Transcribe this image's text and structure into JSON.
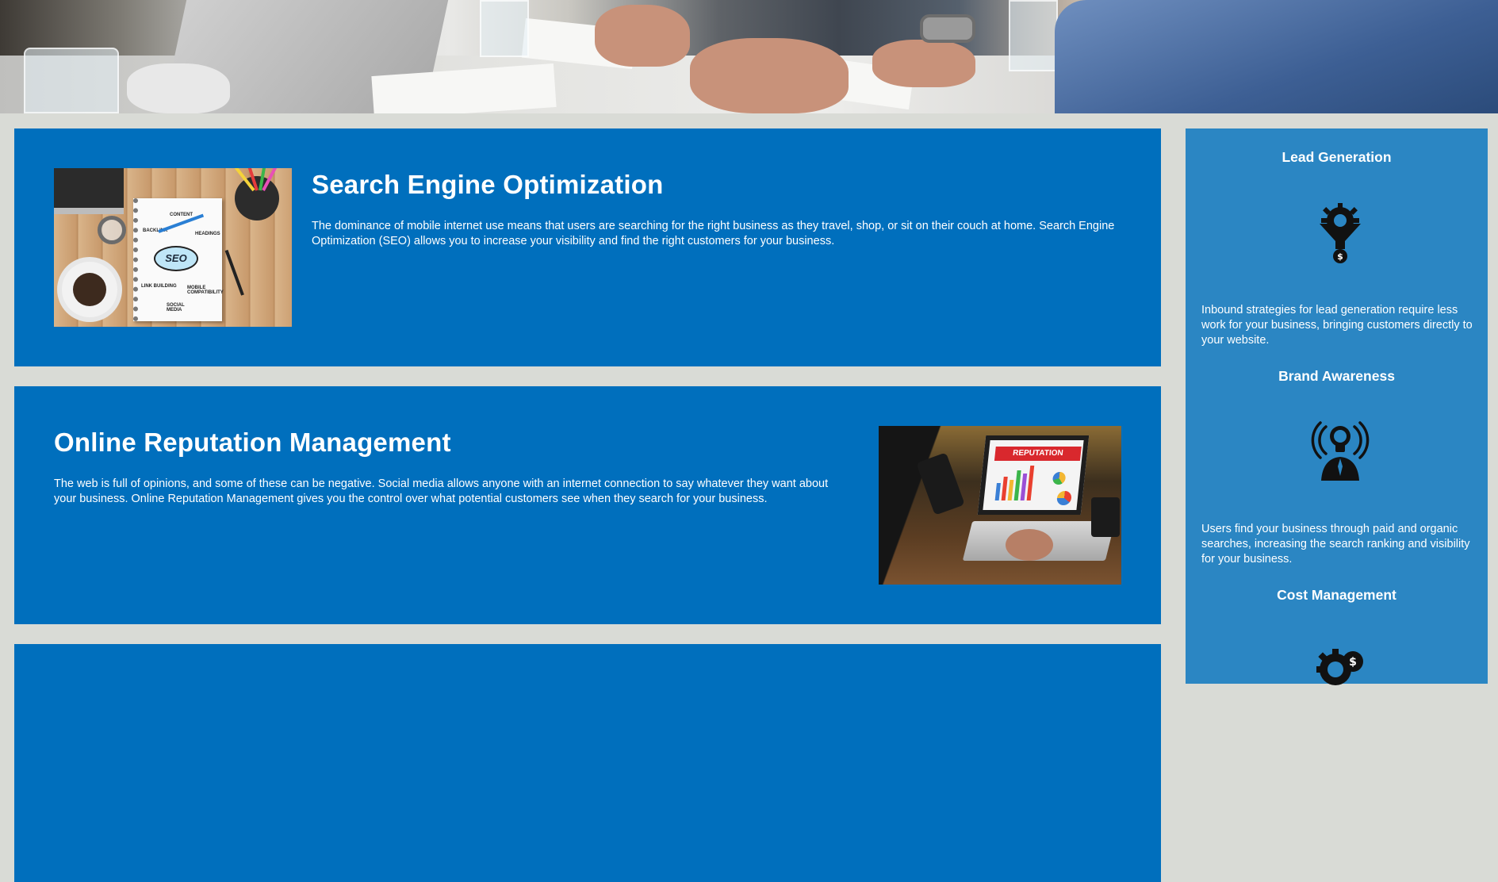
{
  "hero": {
    "image": "meeting-table-photo"
  },
  "services": [
    {
      "title": "Search Engine Optimization",
      "description": "The dominance of mobile internet use means that users are searching for the right business as they travel, shop, or sit on their couch at home. Search Engine Optimization (SEO) allows you to increase your visibility and find the right customers for your business.",
      "image": "seo-notebook-photo",
      "image_text": {
        "cloud": "SEO",
        "content": "CONTENT",
        "backlink": "BACKLINK",
        "headings": "HEADINGS",
        "link_building": "LINK BUILDING",
        "mobile": "MOBILE COMPATIBILITY",
        "social": "SOCIAL MEDIA"
      }
    },
    {
      "title": "Online Reputation Management",
      "description": "The web is full of opinions, and some of these can be negative. Social media allows anyone with an internet connection to say whatever they want about your business. Online Reputation Management gives you the control over what potential customers see when they search for your business.",
      "image": "reputation-laptop-photo",
      "image_text": {
        "banner": "REPUTATION"
      }
    }
  ],
  "sidebar": {
    "background": "#2b86c3",
    "items": [
      {
        "title": "Lead Generation",
        "icon": "funnel-gear-dollar-icon",
        "text": "Inbound strategies for lead generation require less work for your business, bringing customers directly to your website."
      },
      {
        "title": "Brand Awareness",
        "icon": "lightbulb-broadcast-person-icon",
        "text": "Users find your business through paid and organic searches, increasing the search ranking and visibility for your business."
      },
      {
        "title": "Cost Management",
        "icon": "gears-dollar-icon",
        "text": ""
      }
    ]
  },
  "colors": {
    "page_bg": "#d9dbd6",
    "card_bg": "#006fbd",
    "text": "#ffffff"
  }
}
